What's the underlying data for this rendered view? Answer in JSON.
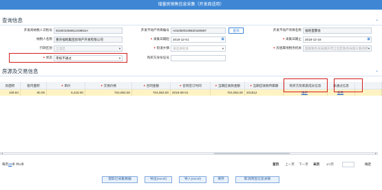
{
  "window": {
    "title": "增量房销售信息采集（开发商适用）"
  },
  "section1": {
    "title": "查询信息"
  },
  "form": {
    "r1": {
      "taxpayer_id_label": "开发商纳税人识别号",
      "taxpayer_id_value": "91500105691243851H",
      "project_no_label": "开发不动产项目编号",
      "project_no_value": "A010500105820160667",
      "query_label": "查询",
      "project_name_label": "开发不动产项目名称",
      "project_name_value": "福地首都会"
    },
    "r2": {
      "taxpayer_name_label": "纳税人名称",
      "taxpayer_name_value": "重庆福地集团房地产开发有限公司",
      "start_date_label": "采集日期起",
      "start_date_value": "2018-12-01",
      "end_date_label": "采集日期止",
      "end_date_value": "2018-12-18"
    },
    "r3": {
      "district_label": "行政区划",
      "district_value": "江北区",
      "street_label": "街道乡镇",
      "street_placeholder": "请选择街道",
      "tax_office_label": "房屋属地税务机关",
      "tax_office_value": "国家税务总局重庆市江北区税务局第三税务所"
    },
    "r4": {
      "status_label": "状态",
      "status_value": "审核不通过",
      "buyer_id_label": "购买方身份证号",
      "buyer_id_value": ""
    }
  },
  "section2": {
    "title": "房源及交易信息"
  },
  "table": {
    "headers": [
      "房面积",
      "套内面积",
      "单价",
      "交易价格",
      "合同金额",
      "合同签订时间",
      "当期应收款金额",
      "当期应收款所属期",
      "购买方及家庭成员信息",
      "未通过信息"
    ],
    "required": [
      false,
      false,
      true,
      true,
      true,
      true,
      true,
      true,
      false,
      false
    ],
    "row": [
      "109.84",
      "90.06",
      "6,418.00",
      "704,953.00",
      "704,953.00",
      "2018-08-01",
      "704,953.00",
      "201812",
      "维护",
      "查看"
    ]
  },
  "pager": {
    "per_page_prefix": "每页",
    "per_page": "20",
    "per_page_suffix": "条 共1条",
    "first": "首页",
    "prev": "上一页",
    "next": "下一页",
    "last": "末页",
    "page_info": "1/1页",
    "go": "确定"
  },
  "buttons": {
    "extract": "提取已采集数据",
    "export": "导出(excel)",
    "import": "导入(excel)",
    "save": "保存",
    "cancel_link": "取消网签信息关联"
  },
  "colors": {
    "header_blue": "#3f87d5",
    "highlight_row": "#fff3c4",
    "annotation_red": "#d41c1c"
  }
}
